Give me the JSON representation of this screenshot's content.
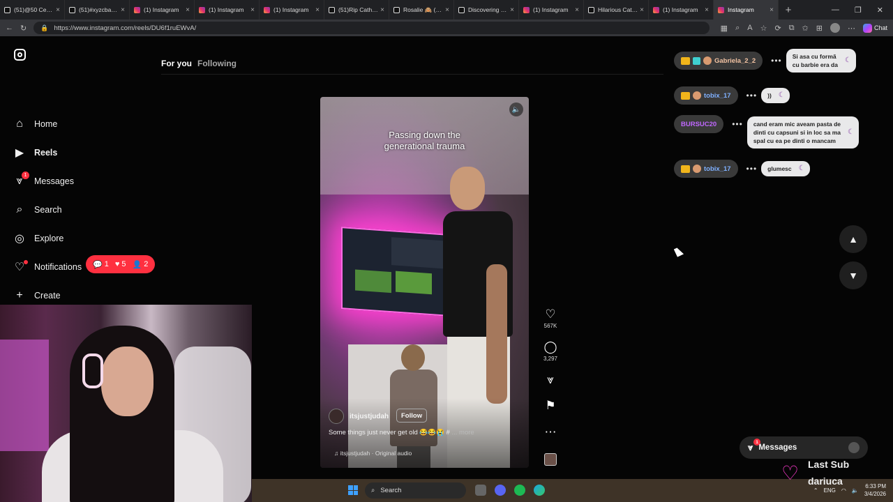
{
  "browser": {
    "tabs": [
      {
        "title": "(51)@50 Cent o",
        "icon": "tiktok",
        "active": false
      },
      {
        "title": "(51)#xyzcba#fy",
        "icon": "tiktok",
        "active": false
      },
      {
        "title": "(1) Instagram",
        "icon": "instagram",
        "active": false
      },
      {
        "title": "(1) Instagram",
        "icon": "instagram",
        "active": false
      },
      {
        "title": "(1) Instagram",
        "icon": "instagram",
        "active": false
      },
      {
        "title": "(51)Rip Catheri",
        "icon": "tiktok",
        "active": false
      },
      {
        "title": "Rosalie 🙈 (@r",
        "icon": "tiktok",
        "active": false
      },
      {
        "title": "Discovering My",
        "icon": "tiktok",
        "active": false
      },
      {
        "title": "(1) Instagram",
        "icon": "instagram",
        "active": false
      },
      {
        "title": "Hilarious Cat St",
        "icon": "tiktok",
        "active": false
      },
      {
        "title": "(1) Instagram",
        "icon": "instagram",
        "active": false
      },
      {
        "title": "Instagram",
        "icon": "instagram",
        "active": true
      }
    ],
    "url": "https://www.instagram.com/reels/DU6f1ruEWvA/",
    "chat_label": "Chat"
  },
  "instagram": {
    "nav": [
      {
        "label": "Home",
        "icon": "home-icon"
      },
      {
        "label": "Reels",
        "icon": "reels-icon",
        "bold": true
      },
      {
        "label": "Messages",
        "icon": "messages-icon",
        "badge": "1"
      },
      {
        "label": "Search",
        "icon": "search-icon"
      },
      {
        "label": "Explore",
        "icon": "explore-icon"
      },
      {
        "label": "Notifications",
        "icon": "heart-icon",
        "dot": true
      },
      {
        "label": "Create",
        "icon": "plus-icon"
      }
    ],
    "notif_pill": {
      "comments": "1",
      "likes": "5",
      "follows": "2"
    },
    "feed_tabs": {
      "active": "For you",
      "inactive": "Following"
    },
    "reel": {
      "overlay_text_line1": "Passing down the",
      "overlay_text_line2": "generational trauma",
      "username": "itsjustjudah",
      "follow_label": "Follow",
      "caption": "Some things just never get old 😂😂😭 #",
      "more_label": "... more",
      "audio": "itsjustjudah · Original audio"
    },
    "actions": {
      "likes": "567K",
      "comments": "3,297"
    },
    "messages_bar": {
      "label": "Messages",
      "badge": "1"
    }
  },
  "chat_overlay": [
    {
      "user": "Gabriela_2_2",
      "message_line1": "Si asa cu formă",
      "message_line2": "cu barbie era da",
      "name_color": "#f3c3a3"
    },
    {
      "user": "tobix_17",
      "message_line1": "))",
      "message_line2": "",
      "name_color": "#7fb0ff"
    },
    {
      "user": "BURSUC20",
      "message_line1": "cand eram mic aveam pasta de",
      "message_line2": "dinti cu capsuni si in loc sa ma",
      "message_line3": "spal cu ea pe dinti o mancam",
      "name_color": "#c068ff"
    },
    {
      "user": "tobix_17",
      "message_line1": "glumesc",
      "message_line2": "",
      "name_color": "#7fb0ff"
    }
  ],
  "stream_overlay": {
    "last_sub_label": "Last Sub",
    "last_sub_name": "dariuca"
  },
  "taskbar": {
    "search_label": "Search",
    "lang": "ENG",
    "time": "6:33 PM",
    "date": "3/4/2026"
  }
}
